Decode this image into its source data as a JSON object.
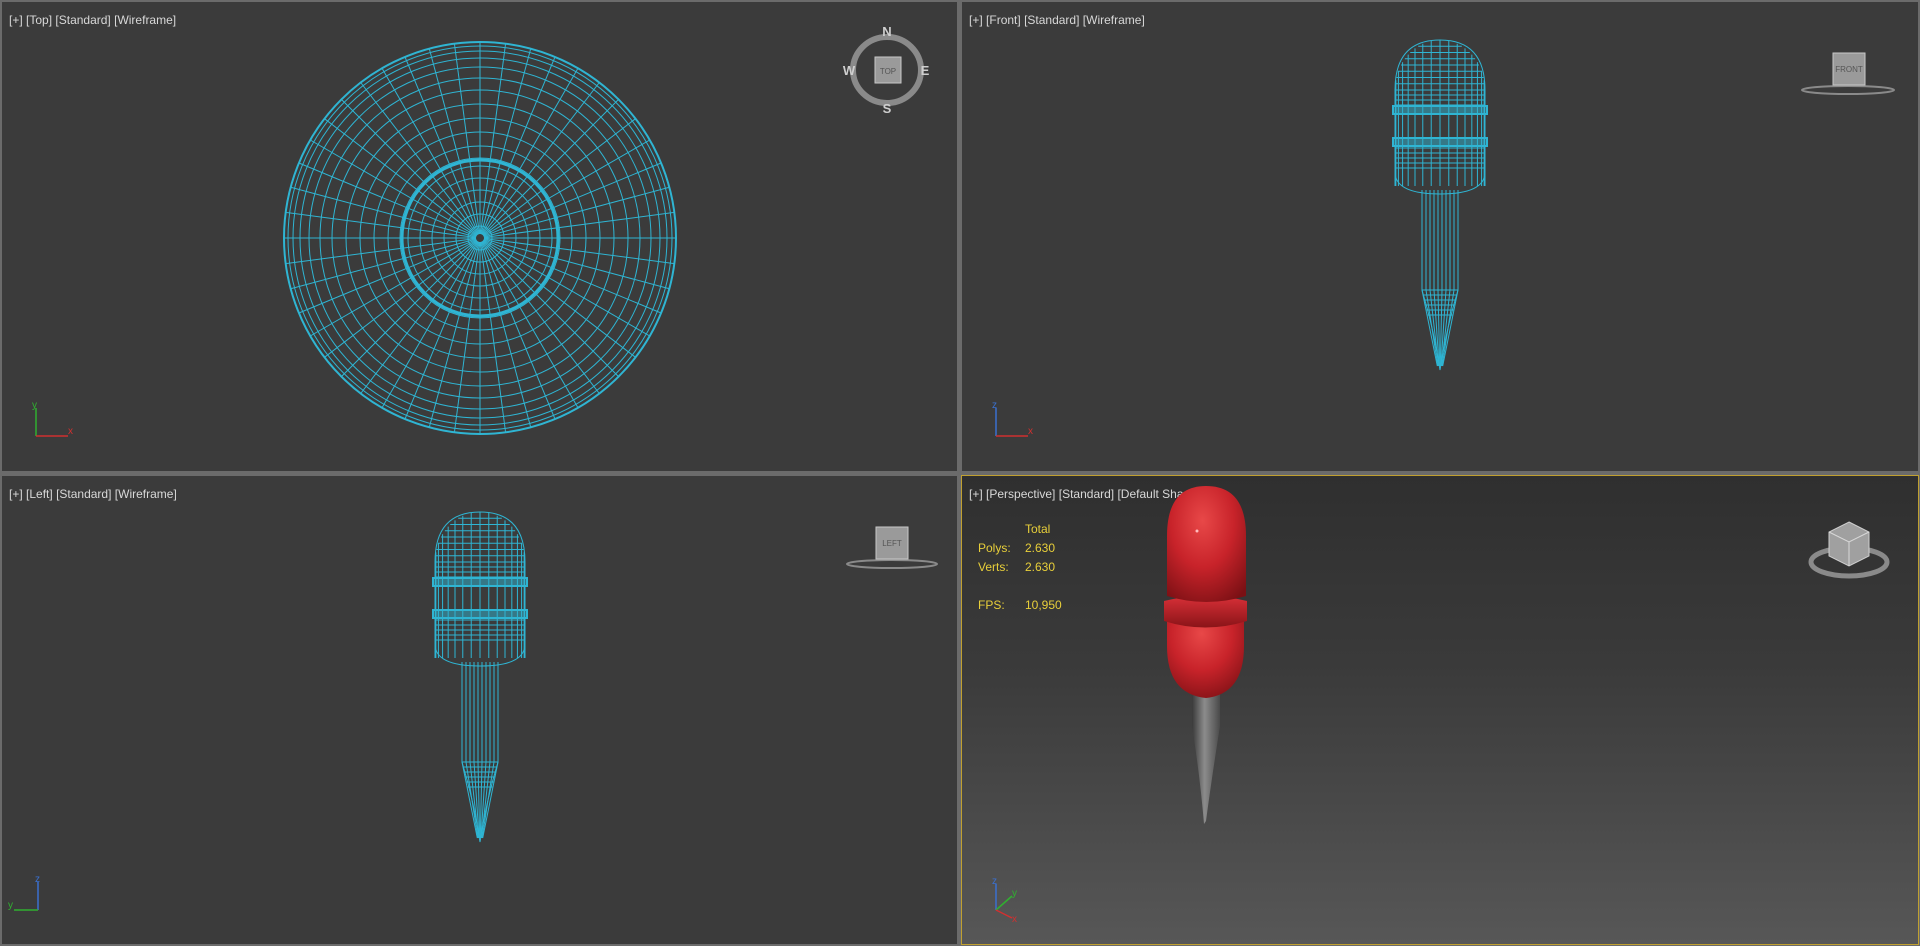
{
  "viewports": {
    "top": {
      "plus": "[+]",
      "view": "[Top]",
      "renderer": "[Standard]",
      "shading": "[Wireframe]",
      "cube": "TOP"
    },
    "front": {
      "plus": "[+]",
      "view": "[Front]",
      "renderer": "[Standard]",
      "shading": "[Wireframe]",
      "cube": "FRONT"
    },
    "left": {
      "plus": "[+]",
      "view": "[Left]",
      "renderer": "[Standard]",
      "shading": "[Wireframe]",
      "cube": "LEFT"
    },
    "perspective": {
      "plus": "[+]",
      "view": "[Perspective]",
      "renderer": "[Standard]",
      "shading": "[Default Shading]",
      "stats": {
        "header": "Total",
        "polys_label": "Polys:",
        "polys_value": "2.630",
        "verts_label": "Verts:",
        "verts_value": "2.630",
        "fps_label": "FPS:",
        "fps_value": "10,950"
      }
    }
  },
  "compass": {
    "n": "N",
    "s": "S",
    "e": "E",
    "w": "W"
  },
  "axes": {
    "top": {
      "a": "y",
      "b": "x"
    },
    "front": {
      "a": "z",
      "b": "x"
    },
    "left": {
      "a": "z",
      "b": "y"
    },
    "persp": {
      "a": "z",
      "b": "y",
      "c": "x"
    }
  },
  "colors": {
    "viewport_bg": "#3b3b3b",
    "wireframe": "#2fb5d3",
    "active_border": "#c0a030",
    "stats_text": "#e8cf3a",
    "model_red": "#c8232a",
    "axis_x": "#d03030",
    "axis_y": "#30b030",
    "axis_z": "#3a70d0"
  },
  "icons": {
    "view_cube": "view-cube-icon",
    "compass": "compass-ring-icon",
    "axis_tripod": "axis-tripod-icon"
  }
}
